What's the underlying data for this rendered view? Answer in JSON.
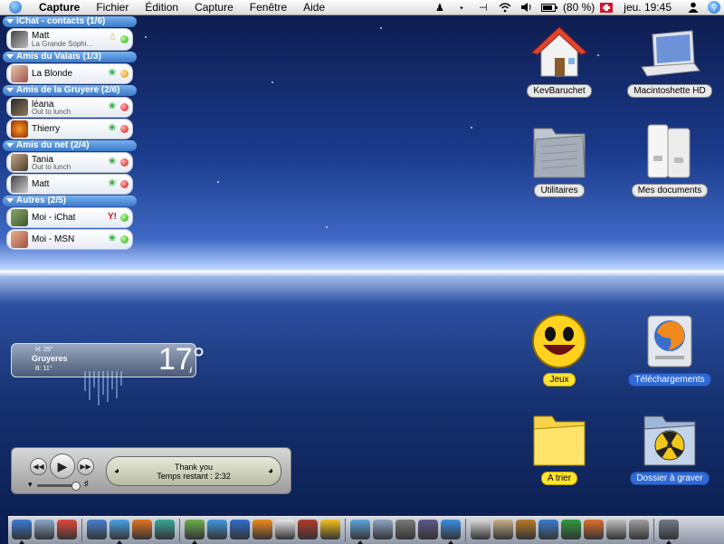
{
  "menubar": {
    "menus": [
      "Capture",
      "Fichier",
      "Édition",
      "Capture",
      "Fenêtre",
      "Aide"
    ],
    "battery": "(80 %)",
    "clock": "jeu. 19:45",
    "status_icons": [
      "dog-icon",
      "butterfly-icon",
      "bracket-icon",
      "wifi-icon",
      "volume-icon",
      "battery-icon",
      "swiss-flag-icon",
      "user-icon",
      "spotlight-icon"
    ]
  },
  "buddy_list": {
    "groups": [
      {
        "title": "iChat - contacts (1/6)",
        "buddies": [
          {
            "name": "Matt",
            "status": "La Grande Sophi...",
            "service": "aim",
            "dot": "green"
          }
        ]
      },
      {
        "title": "Amis du Valais (1/3)",
        "buddies": [
          {
            "name": "La Blonde",
            "status": "",
            "service": "msn",
            "dot": "orange"
          }
        ]
      },
      {
        "title": "Amis de la Gruyere (2/6)",
        "buddies": [
          {
            "name": "léana",
            "status": "Out to lunch",
            "service": "msn",
            "dot": "red"
          },
          {
            "name": "Thierry",
            "status": "",
            "service": "msn",
            "dot": "red"
          }
        ]
      },
      {
        "title": "Amis du net (2/4)",
        "buddies": [
          {
            "name": "Tania",
            "status": "Out to lunch",
            "service": "msn",
            "dot": "red"
          },
          {
            "name": "Matt",
            "status": "",
            "service": "msn",
            "dot": "red"
          }
        ]
      },
      {
        "title": "Autres (2/5)",
        "buddies": [
          {
            "name": "Moi - iChat",
            "status": "",
            "service": "yahoo",
            "dot": "green"
          },
          {
            "name": "Moi - MSN",
            "status": "",
            "service": "msn",
            "dot": "green"
          }
        ]
      }
    ]
  },
  "desktop_icons": [
    {
      "label": "KevBaruchet",
      "icon": "home-icon",
      "style": "gray"
    },
    {
      "label": "Macintoshette HD",
      "icon": "laptop-icon",
      "style": "gray"
    },
    {
      "label": "Utilitaires",
      "icon": "folder-icon",
      "style": "gray"
    },
    {
      "label": "Mes documents",
      "icon": "binders-icon",
      "style": "gray"
    },
    {
      "label": "Jeux",
      "icon": "smiley-icon",
      "style": "yellow"
    },
    {
      "label": "Téléchargements",
      "icon": "firefox-drive-icon",
      "style": "blue"
    },
    {
      "label": "A trier",
      "icon": "yellow-folder-icon",
      "style": "yellow"
    },
    {
      "label": "Dossier à graver",
      "icon": "burn-folder-icon",
      "style": "blue"
    }
  ],
  "weather": {
    "high": "H: 25°",
    "city": "Gruyeres",
    "low": "B: 11°",
    "temp": "17°",
    "info": "i"
  },
  "player": {
    "track": "Thank you",
    "remaining": "Temps restant : 2:32"
  },
  "dock": {
    "items": [
      {
        "icon": "finder-icon",
        "color": "#3b7bd6"
      },
      {
        "icon": "mail-icon",
        "color": "#8aa7c7"
      },
      {
        "icon": "ical-icon",
        "color": "#e14b3a"
      },
      {
        "icon": "omnioutliner-icon",
        "color": "#4a7fcf"
      },
      {
        "icon": "safari-icon",
        "color": "#4aa3e8"
      },
      {
        "icon": "firefox-icon",
        "color": "#e6731f"
      },
      {
        "icon": "adium-icon",
        "color": "#3aa89a"
      },
      {
        "icon": "itunes-icon",
        "color": "#6ab04c"
      },
      {
        "icon": "ichat-icon",
        "color": "#3f9be0"
      },
      {
        "icon": "quicktime-icon",
        "color": "#2e6fd0"
      },
      {
        "icon": "vlc-icon",
        "color": "#f08a1c"
      },
      {
        "icon": "ipod-icon",
        "color": "#e8e8e8"
      },
      {
        "icon": "game-icon",
        "color": "#b33a2a"
      },
      {
        "icon": "toast-icon",
        "color": "#f2c21b"
      },
      {
        "icon": "iphoto-icon",
        "color": "#5da4e0"
      },
      {
        "icon": "preview-icon",
        "color": "#8ca6c2"
      },
      {
        "icon": "photo-booth-icon",
        "color": "#7a7a7a"
      },
      {
        "icon": "imovie-icon",
        "color": "#5a5a8a"
      },
      {
        "icon": "idvd-icon",
        "color": "#3d8fe4"
      },
      {
        "icon": "textedit-icon",
        "color": "#d9d9d9"
      },
      {
        "icon": "addressbook-icon",
        "color": "#c9b08a"
      },
      {
        "icon": "stuffit-icon",
        "color": "#b77a2a"
      },
      {
        "icon": "word-icon",
        "color": "#3a7fd0"
      },
      {
        "icon": "excel-icon",
        "color": "#2f9a3e"
      },
      {
        "icon": "powerpoint-icon",
        "color": "#e0702a"
      },
      {
        "icon": "apple-icon",
        "color": "#c0c0c0"
      },
      {
        "icon": "scissors-icon",
        "color": "#a0a0a0"
      },
      {
        "icon": "trash-icon",
        "color": "#707a88"
      }
    ]
  }
}
